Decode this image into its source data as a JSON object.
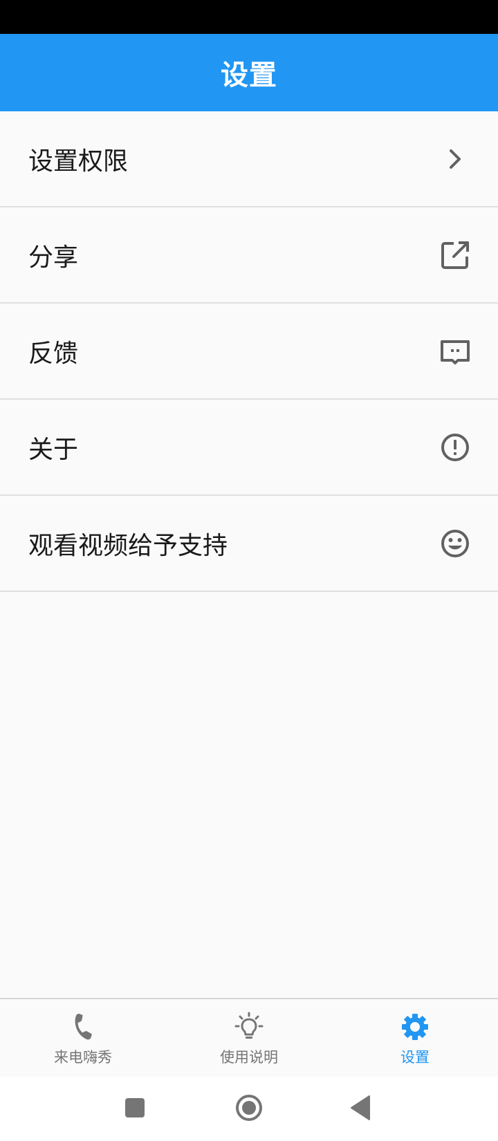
{
  "app_bar": {
    "title": "设置"
  },
  "settings": {
    "items": [
      {
        "label": "设置权限",
        "icon": "chevron-right-icon"
      },
      {
        "label": "分享",
        "icon": "open-in-new-icon"
      },
      {
        "label": "反馈",
        "icon": "feedback-message-icon"
      },
      {
        "label": "关于",
        "icon": "info-alert-icon"
      },
      {
        "label": "观看视频给予支持",
        "icon": "smiley-face-icon"
      }
    ]
  },
  "bottom_nav": {
    "items": [
      {
        "label": "来电嗨秀",
        "icon": "phone-icon",
        "active": false
      },
      {
        "label": "使用说明",
        "icon": "lightbulb-icon",
        "active": false
      },
      {
        "label": "设置",
        "icon": "gear-icon",
        "active": true
      }
    ]
  },
  "system_nav": {
    "buttons": [
      "recents-square-icon",
      "home-circle-icon",
      "back-triangle-icon"
    ]
  },
  "colors": {
    "primary": "#2196f3",
    "icon_gray": "#616161",
    "nav_inactive": "#757575",
    "background": "#fafafa"
  }
}
